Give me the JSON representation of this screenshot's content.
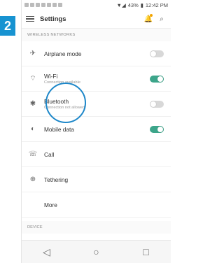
{
  "badge": {
    "number": "2"
  },
  "status_bar": {
    "time": "12:42 PM",
    "battery": "43%"
  },
  "header": {
    "title": "Settings"
  },
  "sections": {
    "wireless": "WIRELESS NETWORKS",
    "device": "DEVICE"
  },
  "settings": [
    {
      "name": "airplane",
      "label": "Airplane mode",
      "sub": "",
      "toggle": "off"
    },
    {
      "name": "wifi",
      "label": "Wi-Fi",
      "sub": "Connection available",
      "toggle": "on"
    },
    {
      "name": "bluetooth",
      "label": "Bluetooth",
      "sub": "Connection not allowed",
      "toggle": "off"
    },
    {
      "name": "mobile-data",
      "label": "Mobile data",
      "sub": "",
      "toggle": "on"
    },
    {
      "name": "call",
      "label": "Call",
      "sub": "",
      "toggle": null
    },
    {
      "name": "tethering",
      "label": "Tethering",
      "sub": "",
      "toggle": null
    },
    {
      "name": "more",
      "label": "More",
      "sub": "",
      "toggle": null
    }
  ],
  "nav": {
    "back": "◁",
    "home": "○",
    "recent": "□"
  }
}
